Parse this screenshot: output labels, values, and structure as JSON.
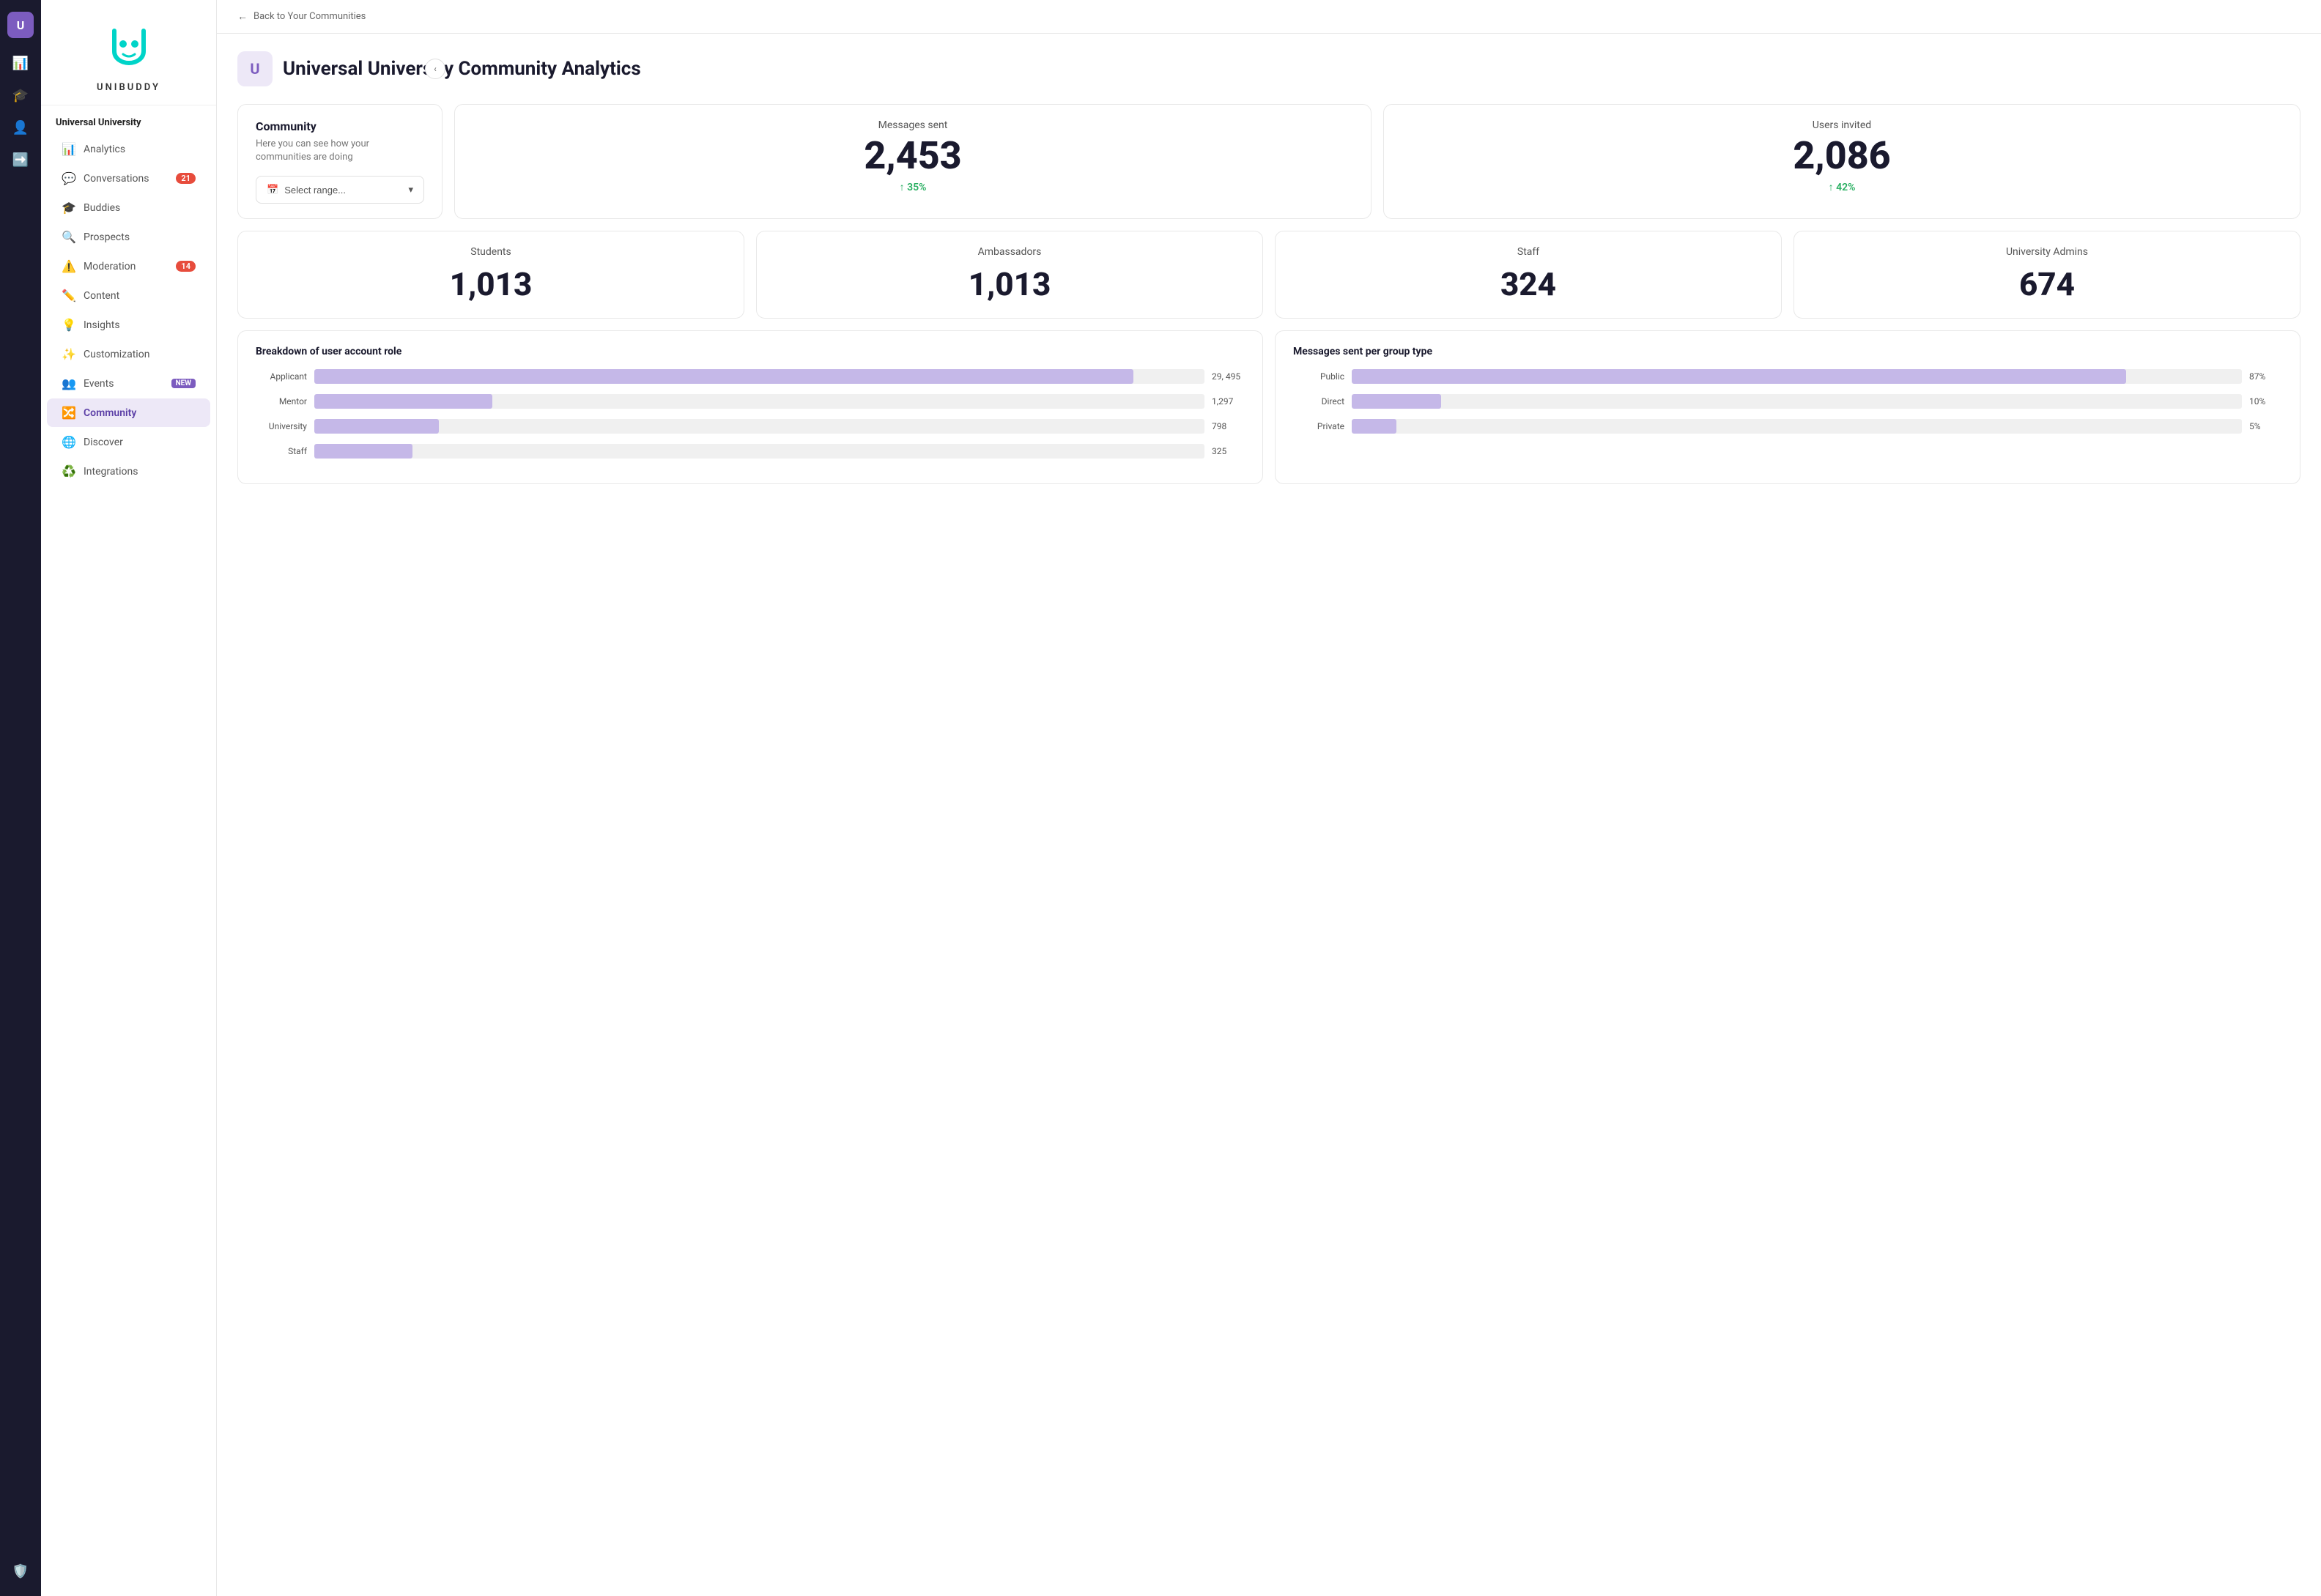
{
  "iconRail": {
    "avatarLabel": "U",
    "icons": [
      "📊",
      "🎓",
      "👤",
      "➡️"
    ]
  },
  "sidebar": {
    "brandName": "UNIBUDDY",
    "sectionTitle": "Universal University",
    "items": [
      {
        "id": "analytics",
        "label": "Analytics",
        "icon": "📊",
        "badge": null,
        "badgeNew": false,
        "active": false
      },
      {
        "id": "conversations",
        "label": "Conversations",
        "icon": "💬",
        "badge": "21",
        "badgeNew": false,
        "active": false
      },
      {
        "id": "buddies",
        "label": "Buddies",
        "icon": "🎓",
        "badge": null,
        "badgeNew": false,
        "active": false
      },
      {
        "id": "prospects",
        "label": "Prospects",
        "icon": "🔍",
        "badge": null,
        "badgeNew": false,
        "active": false
      },
      {
        "id": "moderation",
        "label": "Moderation",
        "icon": "⚠️",
        "badge": "14",
        "badgeNew": false,
        "active": false
      },
      {
        "id": "content",
        "label": "Content",
        "icon": "✏️",
        "badge": null,
        "badgeNew": false,
        "active": false
      },
      {
        "id": "insights",
        "label": "Insights",
        "icon": "💡",
        "badge": null,
        "badgeNew": false,
        "active": false
      },
      {
        "id": "customization",
        "label": "Customization",
        "icon": "✨",
        "badge": null,
        "badgeNew": false,
        "active": false
      },
      {
        "id": "events",
        "label": "Events",
        "icon": "👥",
        "badge": null,
        "badgeNew": true,
        "active": false
      },
      {
        "id": "community",
        "label": "Community",
        "icon": "🔀",
        "badge": null,
        "badgeNew": false,
        "active": true
      },
      {
        "id": "discover",
        "label": "Discover",
        "icon": "🌐",
        "badge": null,
        "badgeNew": false,
        "active": false
      },
      {
        "id": "integrations",
        "label": "Integrations",
        "icon": "♻️",
        "badge": null,
        "badgeNew": false,
        "active": false
      }
    ]
  },
  "topbar": {
    "backLabel": "Back to Your Communities"
  },
  "pageHeader": {
    "iconLabel": "U",
    "title": "Universal University Community Analytics"
  },
  "communityCard": {
    "title": "Community",
    "description": "Here you can see how your communities are doing"
  },
  "dateRange": {
    "placeholder": "Select range...",
    "icon": "📅"
  },
  "messagesSent": {
    "label": "Messages sent",
    "value": "2,453",
    "change": "35%"
  },
  "usersInvited": {
    "label": "Users invited",
    "value": "2,086",
    "change": "42%"
  },
  "userStats": [
    {
      "label": "Students",
      "value": "1,013"
    },
    {
      "label": "Ambassadors",
      "value": "1,013"
    },
    {
      "label": "Staff",
      "value": "324"
    },
    {
      "label": "University Admins",
      "value": "674"
    }
  ],
  "breakdownChart": {
    "title": "Breakdown of user account role",
    "bars": [
      {
        "label": "Applicant",
        "value": "29, 495",
        "pct": 92
      },
      {
        "label": "Mentor",
        "value": "1,297",
        "pct": 20
      },
      {
        "label": "University",
        "value": "798",
        "pct": 14
      },
      {
        "label": "Staff",
        "value": "325",
        "pct": 11
      }
    ]
  },
  "groupTypeChart": {
    "title": "Messages sent per group type",
    "bars": [
      {
        "label": "Public",
        "value": "87%",
        "pct": 87
      },
      {
        "label": "Direct",
        "value": "10%",
        "pct": 10
      },
      {
        "label": "Private",
        "value": "5%",
        "pct": 5
      }
    ]
  }
}
